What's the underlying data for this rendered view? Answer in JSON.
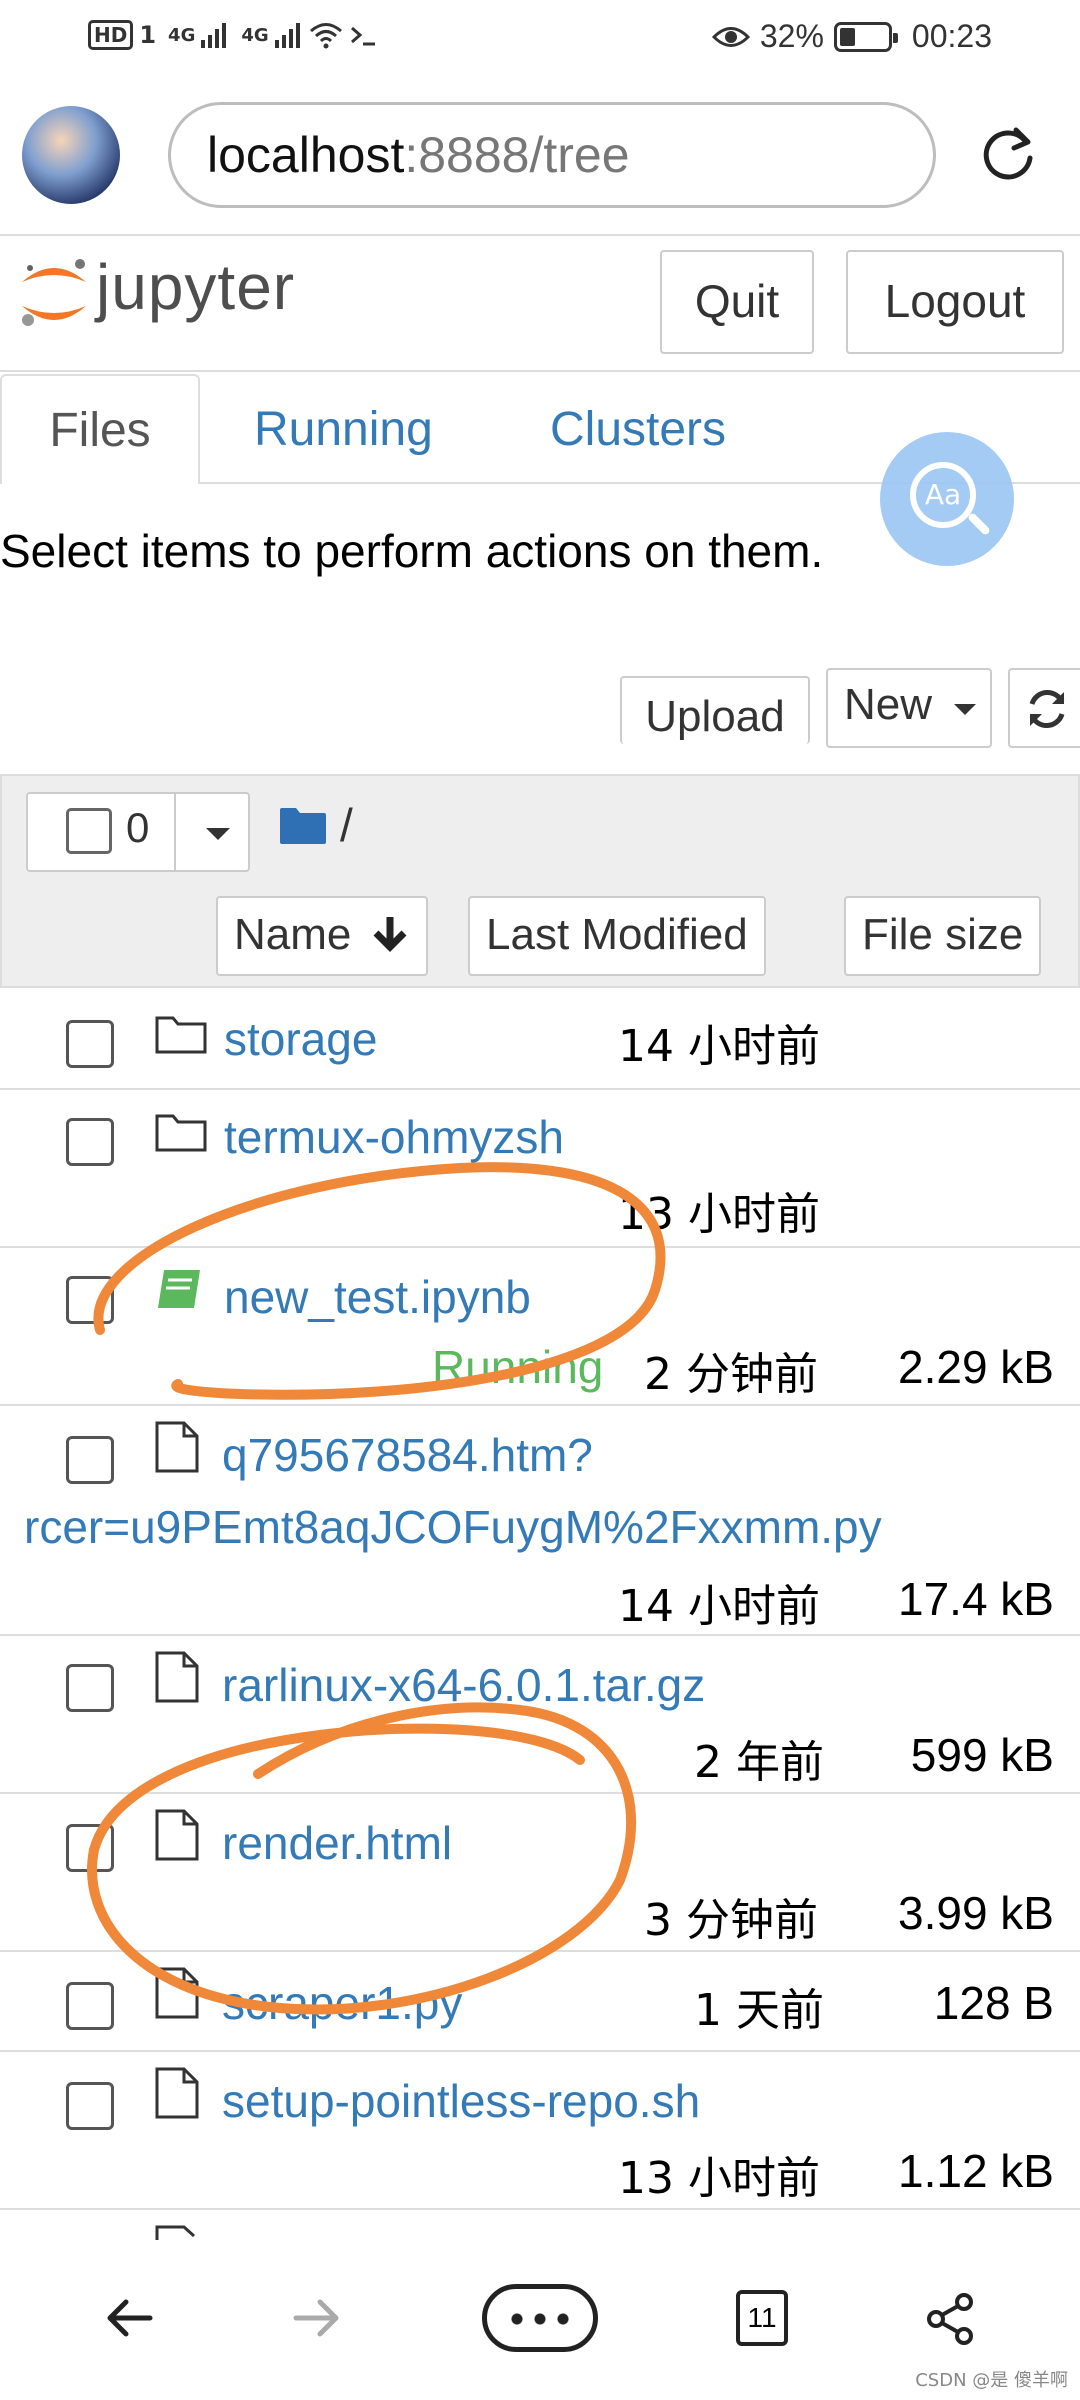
{
  "status_bar": {
    "hd": "HD",
    "sim": "1",
    "net1": "4G",
    "net2": "4G",
    "battery_percent": "32%",
    "battery_level": 0.32,
    "time": "00:23"
  },
  "browser": {
    "url_host": "localhost",
    "url_rest": ":8888/tree"
  },
  "header": {
    "brand": "jupyter",
    "quit_label": "Quit",
    "logout_label": "Logout"
  },
  "tabs": [
    {
      "label": "Files",
      "active": true
    },
    {
      "label": "Running",
      "active": false
    },
    {
      "label": "Clusters",
      "active": false
    }
  ],
  "fab": {
    "label": "Aa"
  },
  "hint": "Select items to perform actions on them.",
  "toolbar": {
    "upload_label": "Upload",
    "new_label": "New"
  },
  "list_header": {
    "selected_count": "0",
    "path": "/",
    "sort_name": "Name",
    "sort_modified": "Last Modified",
    "sort_size": "File size"
  },
  "files": [
    {
      "type": "folder",
      "name": "storage",
      "modified": "14 小时前",
      "size": "",
      "running": ""
    },
    {
      "type": "folder",
      "name": "termux-ohmyzsh",
      "modified": "13 小时前",
      "size": "",
      "running": ""
    },
    {
      "type": "notebook",
      "name": "new_test.ipynb",
      "modified": "2 分钟前",
      "size": "2.29 kB",
      "running": "Running"
    },
    {
      "type": "file",
      "name_line1": "q795678584.htm?",
      "name_line2": "rcer=u9PEmt8aqJCOFuygM%2Fxxmm.py",
      "modified": "14 小时前",
      "size": "17.4 kB",
      "running": ""
    },
    {
      "type": "file",
      "name": "rarlinux-x64-6.0.1.tar.gz",
      "modified": "2 年前",
      "size": "599 kB",
      "running": ""
    },
    {
      "type": "file",
      "name": "render.html",
      "modified": "3 分钟前",
      "size": "3.99 kB",
      "running": ""
    },
    {
      "type": "file",
      "name": "scraper1.py",
      "modified": "1 天前",
      "size": "128 B",
      "running": ""
    },
    {
      "type": "file",
      "name": "setup-pointless-repo.sh",
      "modified": "13 小时前",
      "size": "1.12 kB",
      "running": ""
    }
  ],
  "bottom_nav": {
    "tab_count": "11"
  },
  "watermark": "CSDN @是 傻羊啊",
  "colors": {
    "link_blue": "#337ab7",
    "running_green": "#5cb85c",
    "notebook_green": "#5cb85c",
    "annotation_orange": "#f0883a",
    "jupyter_orange": "#f37726"
  }
}
